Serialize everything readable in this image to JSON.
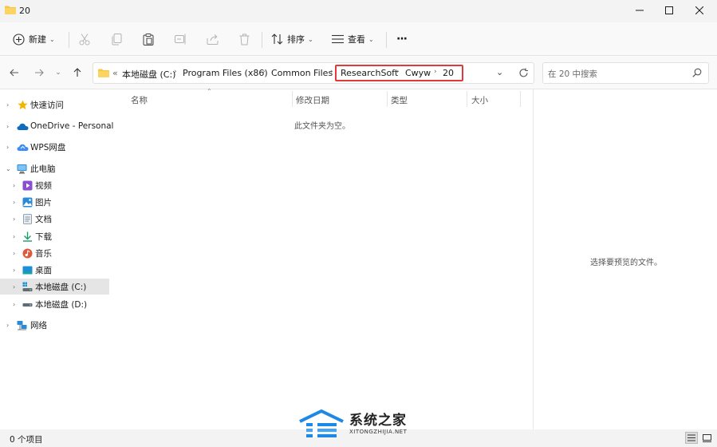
{
  "window": {
    "title": "20"
  },
  "toolbar": {
    "new_label": "新建",
    "sort_label": "排序",
    "view_label": "查看",
    "more_label": "···"
  },
  "nav": {
    "breadcrumbs": [
      "本地磁盘 (C:)",
      "Program Files (x86)",
      "Common Files",
      "ResearchSoft",
      "Cwyw",
      "20"
    ],
    "overflow": "«",
    "search_placeholder": "在 20 中搜索"
  },
  "sidebar": {
    "items": [
      {
        "label": "快速访问",
        "icon": "star-icon"
      },
      {
        "label": "OneDrive - Personal",
        "icon": "cloud-icon"
      },
      {
        "label": "WPS网盘",
        "icon": "wps-cloud-icon"
      },
      {
        "label": "此电脑",
        "icon": "computer-icon"
      },
      {
        "label": "视频",
        "icon": "video-icon"
      },
      {
        "label": "图片",
        "icon": "picture-icon"
      },
      {
        "label": "文档",
        "icon": "document-icon"
      },
      {
        "label": "下载",
        "icon": "download-icon"
      },
      {
        "label": "音乐",
        "icon": "music-icon"
      },
      {
        "label": "桌面",
        "icon": "desktop-icon"
      },
      {
        "label": "本地磁盘 (C:)",
        "icon": "drive-c-icon"
      },
      {
        "label": "本地磁盘 (D:)",
        "icon": "drive-d-icon"
      },
      {
        "label": "网络",
        "icon": "network-icon"
      }
    ]
  },
  "columns": [
    "名称",
    "修改日期",
    "类型",
    "大小"
  ],
  "content": {
    "empty_message": "此文件夹为空。",
    "preview_message": "选择要预览的文件。"
  },
  "status": {
    "item_count": "0 个项目"
  },
  "watermark": {
    "name": "系统之家",
    "url": "XITONGZHIJIA.NET"
  },
  "colors": {
    "accent": "#0067c0",
    "highlight_box": "#e03b3b",
    "folder": "#f8c542"
  }
}
